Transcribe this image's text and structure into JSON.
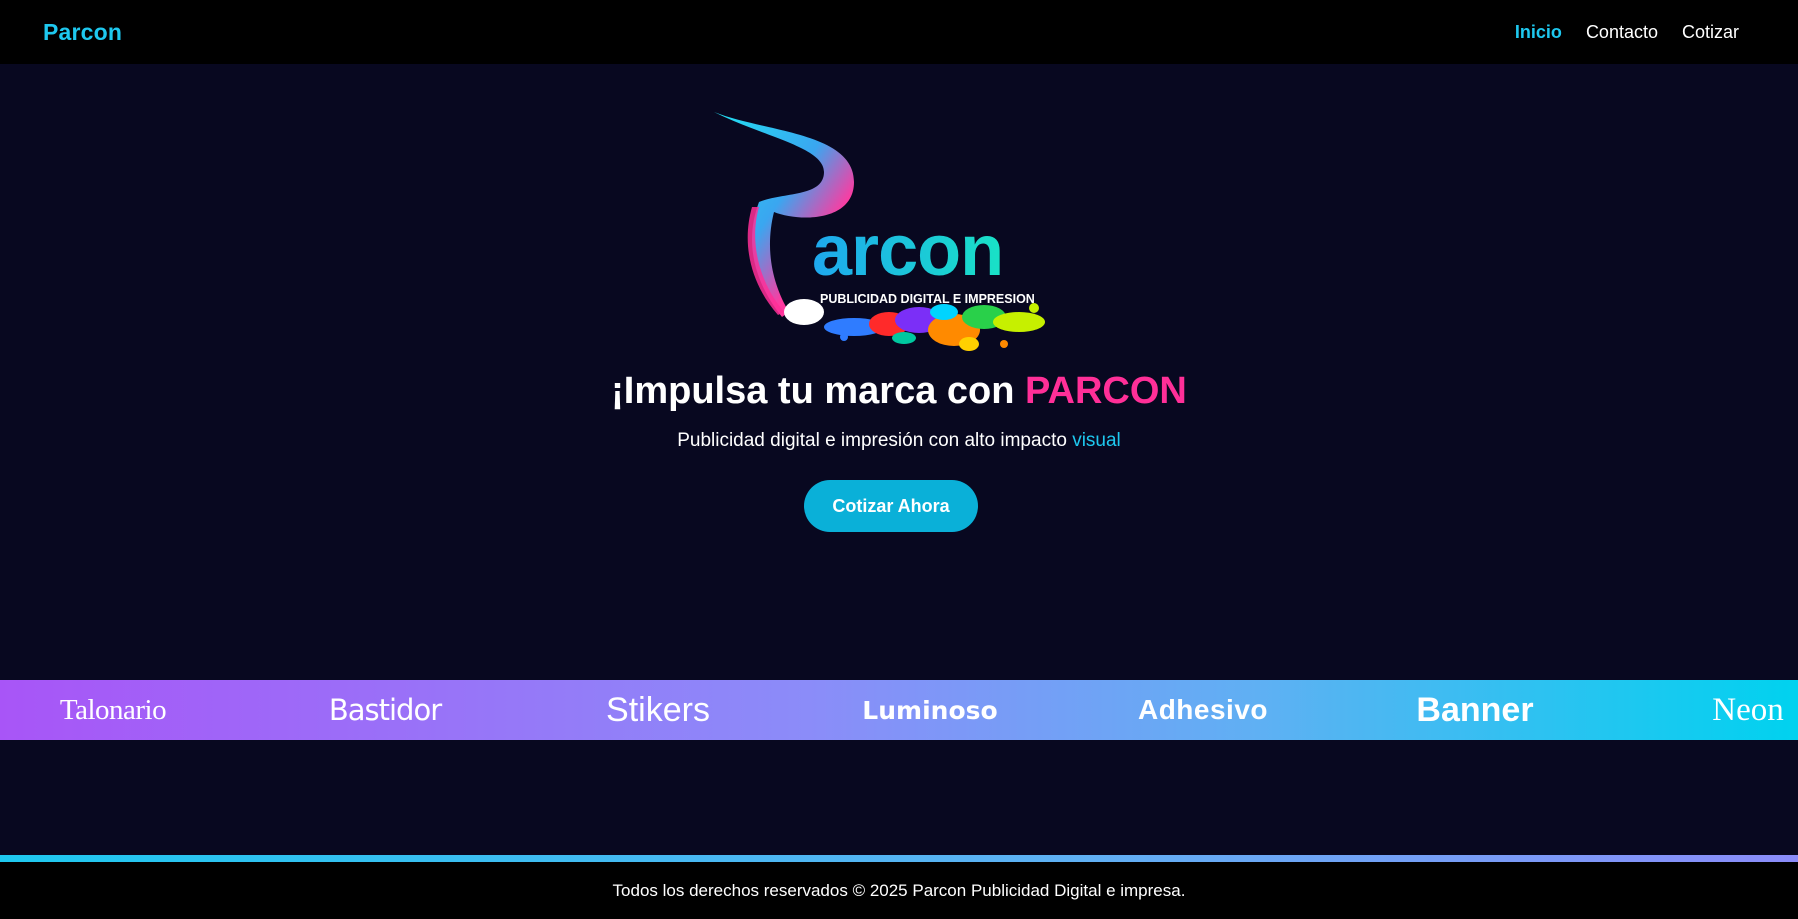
{
  "navbar": {
    "brand": "Parcon",
    "links": [
      {
        "label": "Inicio"
      },
      {
        "label": "Contacto"
      },
      {
        "label": "Cotizar"
      }
    ]
  },
  "logo": {
    "wordmark": "arcon",
    "tagline": "PUBLICIDAD DIGITAL E IMPRESION"
  },
  "hero": {
    "title_prefix": "¡Impulsa tu marca con ",
    "title_accent": "PARCON",
    "subtitle_prefix": "Publicidad digital e impresión con alto impacto ",
    "subtitle_accent": "visual",
    "cta_label": "Cotizar Ahora"
  },
  "products": [
    "Talonario",
    "Bastidor",
    "Stikers",
    "Luminoso",
    "Adhesivo",
    "Banner",
    "Neon"
  ],
  "footer": {
    "text": "Todos los derechos reservados © 2025 Parcon Publicidad Digital e impresa."
  },
  "colors": {
    "background": "#080820",
    "accent_cyan": "#1ec8ef",
    "accent_pink": "#ff2f98",
    "cta": "#0ab0d8"
  }
}
